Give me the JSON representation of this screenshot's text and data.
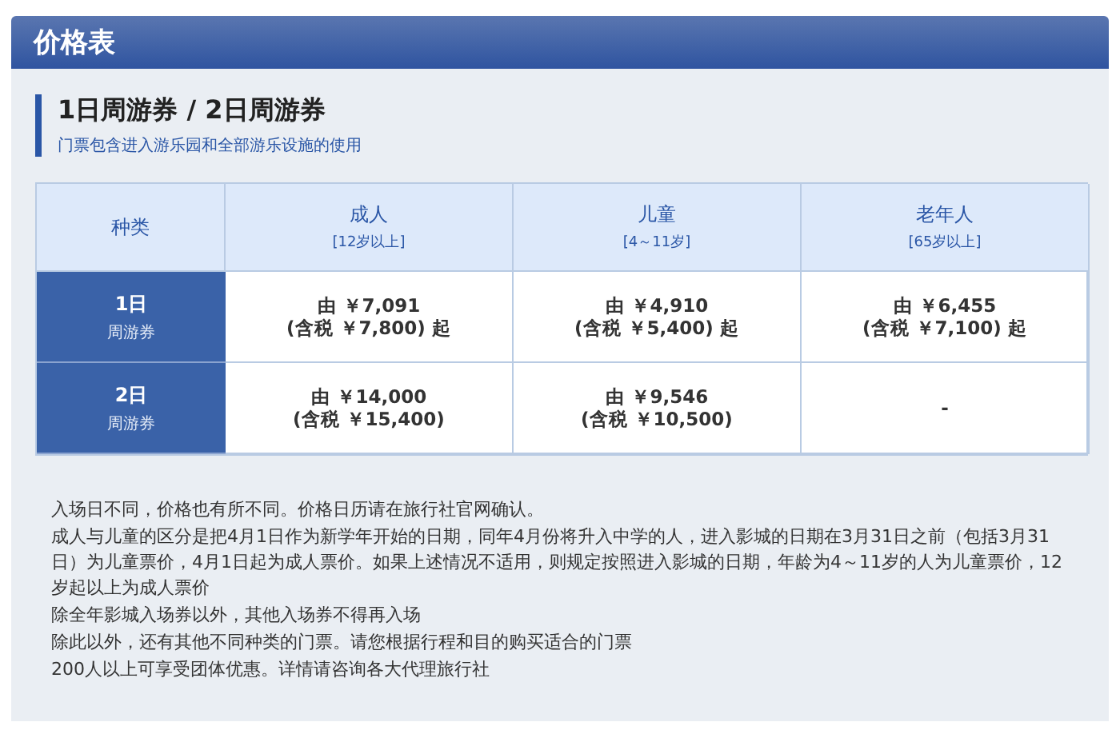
{
  "header": {
    "title": "价格表"
  },
  "section": {
    "title": "1日周游券 / 2日周游券",
    "subtitle": "门票包含进入游乐园和全部游乐设施的使用"
  },
  "table": {
    "corner": "种类",
    "columns": [
      {
        "label": "成人",
        "range": "[12岁以上]"
      },
      {
        "label": "儿童",
        "range": "[4～11岁]"
      },
      {
        "label": "老年人",
        "range": "[65岁以上]"
      }
    ],
    "rows": [
      {
        "label": "1日",
        "sub": "周游券",
        "cells": [
          [
            "由 ￥7,091",
            "(含税 ￥7,800) 起"
          ],
          [
            "由 ￥4,910",
            "(含税 ￥5,400) 起"
          ],
          [
            "由 ￥6,455",
            "(含税 ￥7,100) 起"
          ]
        ]
      },
      {
        "label": "2日",
        "sub": "周游券",
        "cells": [
          [
            "由 ￥14,000",
            "(含税 ￥15,400)"
          ],
          [
            "由 ￥9,546",
            "(含税 ￥10,500)"
          ],
          [
            "-"
          ]
        ]
      }
    ]
  },
  "notes": [
    "入场日不同，价格也有所不同。价格日历请在旅行社官网确认。",
    "成人与儿童的区分是把4月1日作为新学年开始的日期，同年4月份将升入中学的人，进入影城的日期在3月31日之前（包括3月31日）为儿童票价，4月1日起为成人票价。如果上述情况不适用，则规定按照进入影城的日期，年龄为4～11岁的人为儿童票价，12岁起以上为成人票价",
    "除全年影城入场券以外，其他入场券不得再入场",
    "除此以外，还有其他不同种类的门票。请您根据行程和目的购买适合的门票",
    "200人以上可享受团体优惠。详情请咨询各大代理旅行社"
  ]
}
